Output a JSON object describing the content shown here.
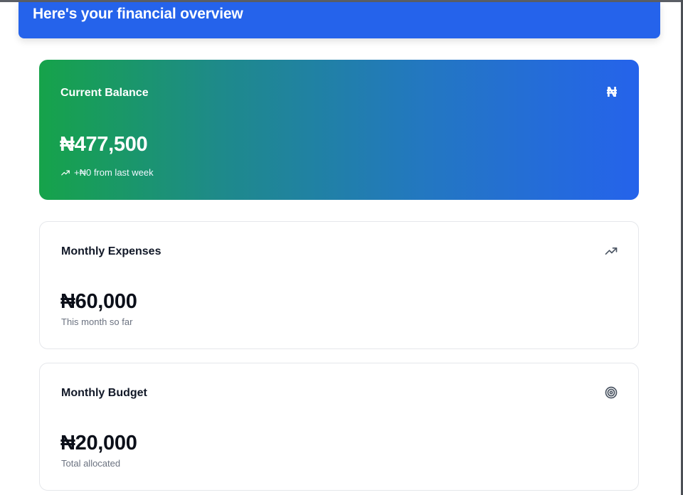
{
  "header": {
    "title": "Here's your financial overview"
  },
  "balance_card": {
    "label": "Current Balance",
    "icon": "naira-icon",
    "icon_glyph": "₦",
    "amount": "₦477,500",
    "change_icon": "trending-up-icon",
    "change_text": "+₦0 from last week"
  },
  "expenses_card": {
    "label": "Monthly Expenses",
    "icon": "trending-up-icon",
    "amount": "₦60,000",
    "subtitle": "This month so far"
  },
  "budget_card": {
    "label": "Monthly Budget",
    "icon": "target-icon",
    "amount": "₦20,000",
    "subtitle": "Total allocated"
  },
  "colors": {
    "header_bg": "#2563eb",
    "balance_gradient_start": "#16a34a",
    "balance_gradient_end": "#2563eb",
    "card_border": "#e5e7eb",
    "muted_text": "#6b7280"
  }
}
